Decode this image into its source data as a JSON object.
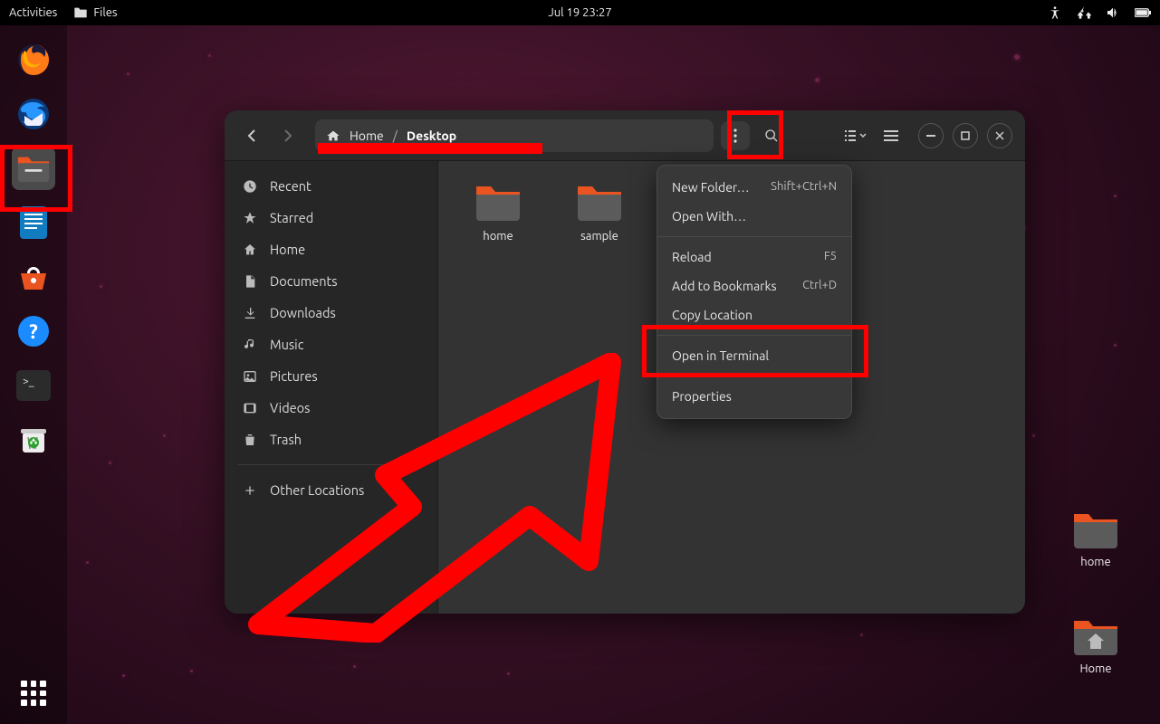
{
  "topbar": {
    "activities": "Activities",
    "files_label": "Files",
    "clock": "Jul 19  23:27"
  },
  "dock": {
    "items": [
      "firefox",
      "thunderbird",
      "files",
      "writer",
      "software",
      "help",
      "terminal",
      "trash"
    ]
  },
  "window": {
    "breadcrumb": {
      "home": "Home",
      "desktop": "Desktop"
    },
    "sidebar": {
      "recent": "Recent",
      "starred": "Starred",
      "home": "Home",
      "documents": "Documents",
      "downloads": "Downloads",
      "music": "Music",
      "pictures": "Pictures",
      "videos": "Videos",
      "trash": "Trash",
      "other": "Other Locations"
    },
    "files": {
      "home": "home",
      "sample": "sample"
    }
  },
  "menu": {
    "new_folder": "New Folder…",
    "new_folder_sc": "Shift+Ctrl+N",
    "open_with": "Open With…",
    "reload": "Reload",
    "reload_sc": "F5",
    "add_bookmarks": "Add to Bookmarks",
    "add_bookmarks_sc": "Ctrl+D",
    "copy_location": "Copy Location",
    "open_terminal": "Open in Terminal",
    "properties": "Properties"
  },
  "desktop_icons": {
    "home": "home",
    "user_home": "Home"
  }
}
